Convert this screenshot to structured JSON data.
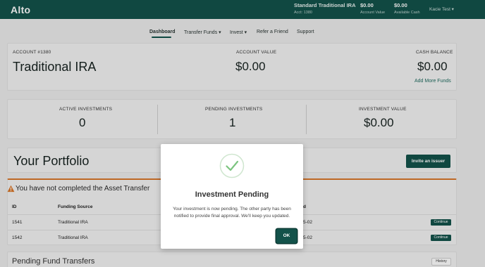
{
  "topbar": {
    "logo": "Alto",
    "account_name": "Standard Traditional IRA",
    "account_number": "Acct: 1380",
    "account_value": "$0.00",
    "account_value_label": "Account Value",
    "available_cash": "$0.00",
    "available_cash_label": "Available Cash",
    "user_name": "Kacie Test ▾"
  },
  "nav": {
    "items": [
      {
        "label": "Dashboard",
        "active": true
      },
      {
        "label": "Transfer Funds ▾"
      },
      {
        "label": "Invest ▾"
      },
      {
        "label": "Refer a Friend"
      },
      {
        "label": "Support"
      }
    ]
  },
  "account_card": {
    "account_label": "ACCOUNT #1380",
    "account_type": "Traditional IRA",
    "value_label": "ACCOUNT VALUE",
    "value": "$0.00",
    "cash_label": "CASH BALANCE",
    "cash": "$0.00",
    "add_funds": "Add More Funds"
  },
  "stats_card": {
    "active_label": "ACTIVE INVESTMENTS",
    "active_value": "0",
    "pending_label": "PENDING INVESTMENTS",
    "pending_value": "1",
    "investment_value_label": "INVESTMENT VALUE",
    "investment_value": "$0.00"
  },
  "portfolio": {
    "title": "Your Portfolio",
    "invite_button": "Invite an issuer"
  },
  "asset_transfer": {
    "warning": "You have not completed the Asset Transfer",
    "columns": [
      "ID",
      "Funding Source",
      "d"
    ],
    "rows": [
      {
        "id": "1541",
        "source": "Traditional IRA",
        "date_fragment": "5-02",
        "action": "Continue"
      },
      {
        "id": "1542",
        "source": "Traditional IRA",
        "date_fragment": "5-02",
        "action": "Continue"
      }
    ]
  },
  "pending_transfers": {
    "title": "Pending Fund Transfers",
    "history_button": "History"
  },
  "modal": {
    "title": "Investment Pending",
    "message": "Your investment is now pending. The other party has been notified to provide final approval. We'll keep you updated.",
    "ok_button": "OK"
  },
  "colors": {
    "brand_green": "#13524a",
    "warning_orange": "#d9772b",
    "check_green": "#7bc47f"
  }
}
